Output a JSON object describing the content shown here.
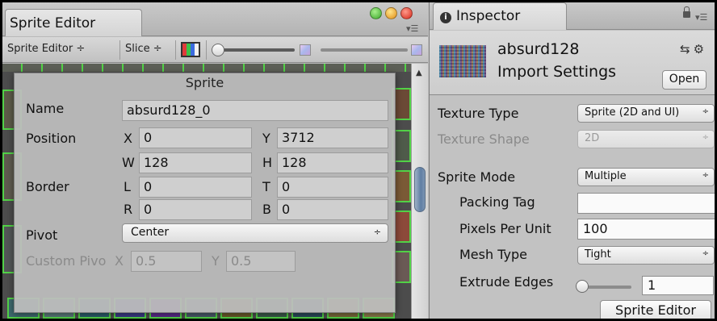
{
  "sprite_editor": {
    "tab_title": "Sprite Editor",
    "toolbar": {
      "mode_label": "Sprite Editor",
      "slice_label": "Slice"
    },
    "panel": {
      "title": "Sprite",
      "name_label": "Name",
      "name_value": "absurd128_0",
      "position_label": "Position",
      "x_label": "X",
      "x_value": "0",
      "y_label": "Y",
      "y_value": "3712",
      "w_label": "W",
      "w_value": "128",
      "h_label": "H",
      "h_value": "128",
      "border_label": "Border",
      "l_label": "L",
      "l_value": "0",
      "t_label": "T",
      "t_value": "0",
      "r_label": "R",
      "r_value": "0",
      "b_label": "B",
      "b_value": "0",
      "pivot_label": "Pivot",
      "pivot_value": "Center",
      "custom_pivot_label": "Custom Pivo",
      "cp_x_label": "X",
      "cp_x_value": "0.5",
      "cp_y_label": "Y",
      "cp_y_value": "0.5"
    }
  },
  "inspector": {
    "tab_title": "Inspector",
    "asset_name": "absurd128",
    "asset_subtitle": "Import Settings",
    "open_button": "Open",
    "properties": {
      "texture_type_label": "Texture Type",
      "texture_type_value": "Sprite (2D and UI)",
      "texture_shape_label": "Texture Shape",
      "texture_shape_value": "2D",
      "sprite_mode_label": "Sprite Mode",
      "sprite_mode_value": "Multiple",
      "packing_tag_label": "Packing Tag",
      "packing_tag_value": "",
      "ppu_label": "Pixels Per Unit",
      "ppu_value": "100",
      "mesh_type_label": "Mesh Type",
      "mesh_type_value": "Tight",
      "extrude_label": "Extrude Edges",
      "extrude_value": "1"
    },
    "sprite_editor_button": "Sprite Editor"
  },
  "icons": [
    "close-icon",
    "minimize-icon",
    "zoom-icon",
    "color-channel-icon",
    "alpha-icon",
    "info-icon",
    "lock-icon",
    "settings-icon"
  ]
}
